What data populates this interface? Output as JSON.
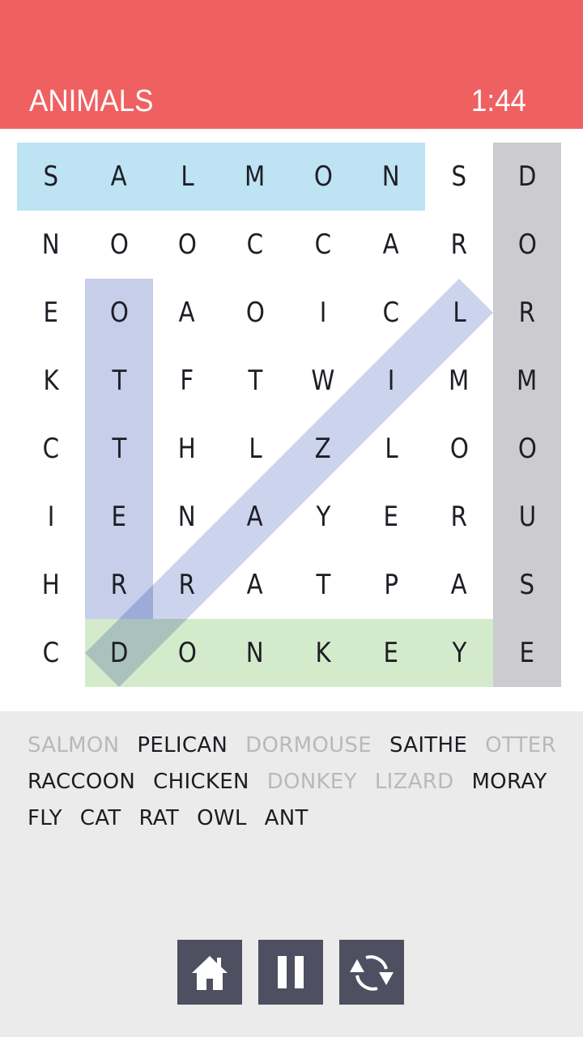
{
  "header": {
    "category": "ANIMALS",
    "timer": "1:44"
  },
  "grid": {
    "rows": [
      [
        "S",
        "A",
        "L",
        "M",
        "O",
        "N",
        "S",
        "D"
      ],
      [
        "N",
        "O",
        "O",
        "C",
        "C",
        "A",
        "R",
        "O"
      ],
      [
        "E",
        "O",
        "A",
        "O",
        "I",
        "C",
        "L",
        "R"
      ],
      [
        "K",
        "T",
        "F",
        "T",
        "W",
        "I",
        "M",
        "M"
      ],
      [
        "C",
        "T",
        "H",
        "L",
        "Z",
        "L",
        "O",
        "O"
      ],
      [
        "I",
        "E",
        "N",
        "A",
        "Y",
        "E",
        "R",
        "U"
      ],
      [
        "H",
        "R",
        "R",
        "A",
        "T",
        "P",
        "A",
        "S"
      ],
      [
        "C",
        "D",
        "O",
        "N",
        "K",
        "E",
        "Y",
        "E"
      ]
    ],
    "found_highlights": [
      {
        "word": "SALMON",
        "start": [
          0,
          0
        ],
        "end": [
          0,
          5
        ],
        "color": "#BEE3F3"
      },
      {
        "word": "DORMOUSE",
        "start": [
          0,
          7
        ],
        "end": [
          7,
          7
        ],
        "color": "#CBCBD0"
      },
      {
        "word": "OTTER",
        "start": [
          2,
          1
        ],
        "end": [
          6,
          1
        ],
        "color": "#C6CEEA"
      },
      {
        "word": "DONKEY",
        "start": [
          7,
          1
        ],
        "end": [
          7,
          6
        ],
        "color": "#D3EBCB"
      },
      {
        "word": "LIZARD",
        "start": [
          2,
          6
        ],
        "end": [
          7,
          1
        ],
        "color": "#C6CEEA"
      }
    ]
  },
  "word_list": {
    "lines": [
      [
        {
          "text": "SALMON",
          "found": true
        },
        {
          "text": "PELICAN",
          "found": false
        },
        {
          "text": "DORMOUSE",
          "found": true
        },
        {
          "text": "SAITHE",
          "found": false
        },
        {
          "text": "OTTER",
          "found": true
        }
      ],
      [
        {
          "text": "RACCOON",
          "found": false
        },
        {
          "text": "CHICKEN",
          "found": false
        },
        {
          "text": "DONKEY",
          "found": true
        },
        {
          "text": "LIZARD",
          "found": true
        },
        {
          "text": "MORAY",
          "found": false
        }
      ],
      [
        {
          "text": "FLY",
          "found": false
        },
        {
          "text": "CAT",
          "found": false
        },
        {
          "text": "RAT",
          "found": false
        },
        {
          "text": "OWL",
          "found": false
        },
        {
          "text": "ANT",
          "found": false
        }
      ]
    ]
  },
  "controls": {
    "buttons": [
      {
        "name": "home-button",
        "icon": "home-icon"
      },
      {
        "name": "pause-button",
        "icon": "pause-icon"
      },
      {
        "name": "restart-button",
        "icon": "refresh-icon"
      }
    ],
    "button_color": "#4E4F60"
  },
  "colors": {
    "header": "#EF6061",
    "found_word_text": "#B9B9BC",
    "word_text": "#1C1C22"
  }
}
